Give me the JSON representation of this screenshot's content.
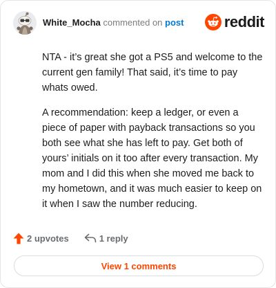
{
  "comment": {
    "author": "White_Mocha",
    "action_text": "commented on",
    "target_link": "post",
    "paragraphs": [
      "NTA - it’s great she got a PS5 and welcome to the current gen family! That said, it’s time to pay whats owed.",
      "A recommendation: keep a ledger, or even a piece of paper with payback transactions so you both see what she has left to pay. Get both of yours’ initials on it too after every transaction. My mom and I did this when she moved me back to my hometown, and it was much easier to keep on it when I saw the number reducing."
    ]
  },
  "brand": {
    "wordmark": "reddit",
    "color": "#ff4500"
  },
  "actions": {
    "upvotes_label": "2 upvotes",
    "upvote_color": "#ff4500",
    "reply_label": "1 reply"
  },
  "view_button": {
    "label": "View 1 comments"
  },
  "icons": {
    "avatar": "snoo-avatar",
    "logo": "reddit-logo-icon",
    "upvote": "upvote-arrow-icon",
    "reply": "reply-arrow-icon"
  }
}
